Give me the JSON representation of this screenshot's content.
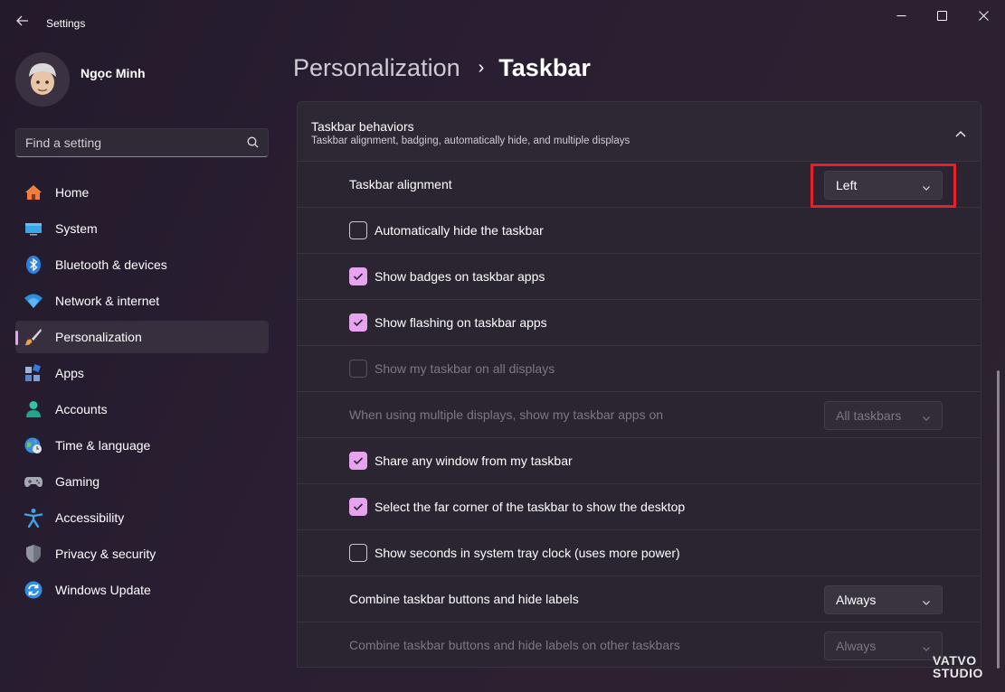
{
  "window": {
    "title": "Settings"
  },
  "profile": {
    "name": "Ngọc Minh"
  },
  "search": {
    "placeholder": "Find a setting"
  },
  "sidebar": {
    "items": [
      {
        "label": "Home",
        "icon": "home-icon"
      },
      {
        "label": "System",
        "icon": "monitor-icon"
      },
      {
        "label": "Bluetooth & devices",
        "icon": "bluetooth-icon"
      },
      {
        "label": "Network & internet",
        "icon": "wifi-icon"
      },
      {
        "label": "Personalization",
        "icon": "brush-icon",
        "active": true
      },
      {
        "label": "Apps",
        "icon": "apps-icon"
      },
      {
        "label": "Accounts",
        "icon": "person-icon"
      },
      {
        "label": "Time & language",
        "icon": "globe-clock-icon"
      },
      {
        "label": "Gaming",
        "icon": "gamepad-icon"
      },
      {
        "label": "Accessibility",
        "icon": "accessibility-icon"
      },
      {
        "label": "Privacy & security",
        "icon": "shield-icon"
      },
      {
        "label": "Windows Update",
        "icon": "update-icon"
      }
    ]
  },
  "breadcrumb": {
    "parent": "Personalization",
    "separator": "›",
    "current": "Taskbar"
  },
  "section": {
    "title": "Taskbar behaviors",
    "subtitle": "Taskbar alignment, badging, automatically hide, and multiple displays"
  },
  "rows": {
    "alignment": {
      "label": "Taskbar alignment",
      "value": "Left"
    },
    "auto_hide": {
      "label": "Automatically hide the taskbar",
      "checked": false
    },
    "badges": {
      "label": "Show badges on taskbar apps",
      "checked": true
    },
    "flashing": {
      "label": "Show flashing on taskbar apps",
      "checked": true
    },
    "all_displays": {
      "label": "Show my taskbar on all displays",
      "checked": false,
      "disabled": true
    },
    "multi_display": {
      "label": "When using multiple displays, show my taskbar apps on",
      "value": "All taskbars",
      "disabled": true
    },
    "share_window": {
      "label": "Share any window from my taskbar",
      "checked": true
    },
    "far_corner": {
      "label": "Select the far corner of the taskbar to show the desktop",
      "checked": true
    },
    "seconds": {
      "label": "Show seconds in system tray clock (uses more power)",
      "checked": false
    },
    "combine": {
      "label": "Combine taskbar buttons and hide labels",
      "value": "Always"
    },
    "combine_other": {
      "label": "Combine taskbar buttons and hide labels on other taskbars",
      "value": "Always",
      "disabled": true
    }
  },
  "watermark": {
    "line1": "VATVO",
    "line2": "STUDIO"
  },
  "colors": {
    "accent": "#e7a3f0",
    "highlight": "#e8202a"
  }
}
